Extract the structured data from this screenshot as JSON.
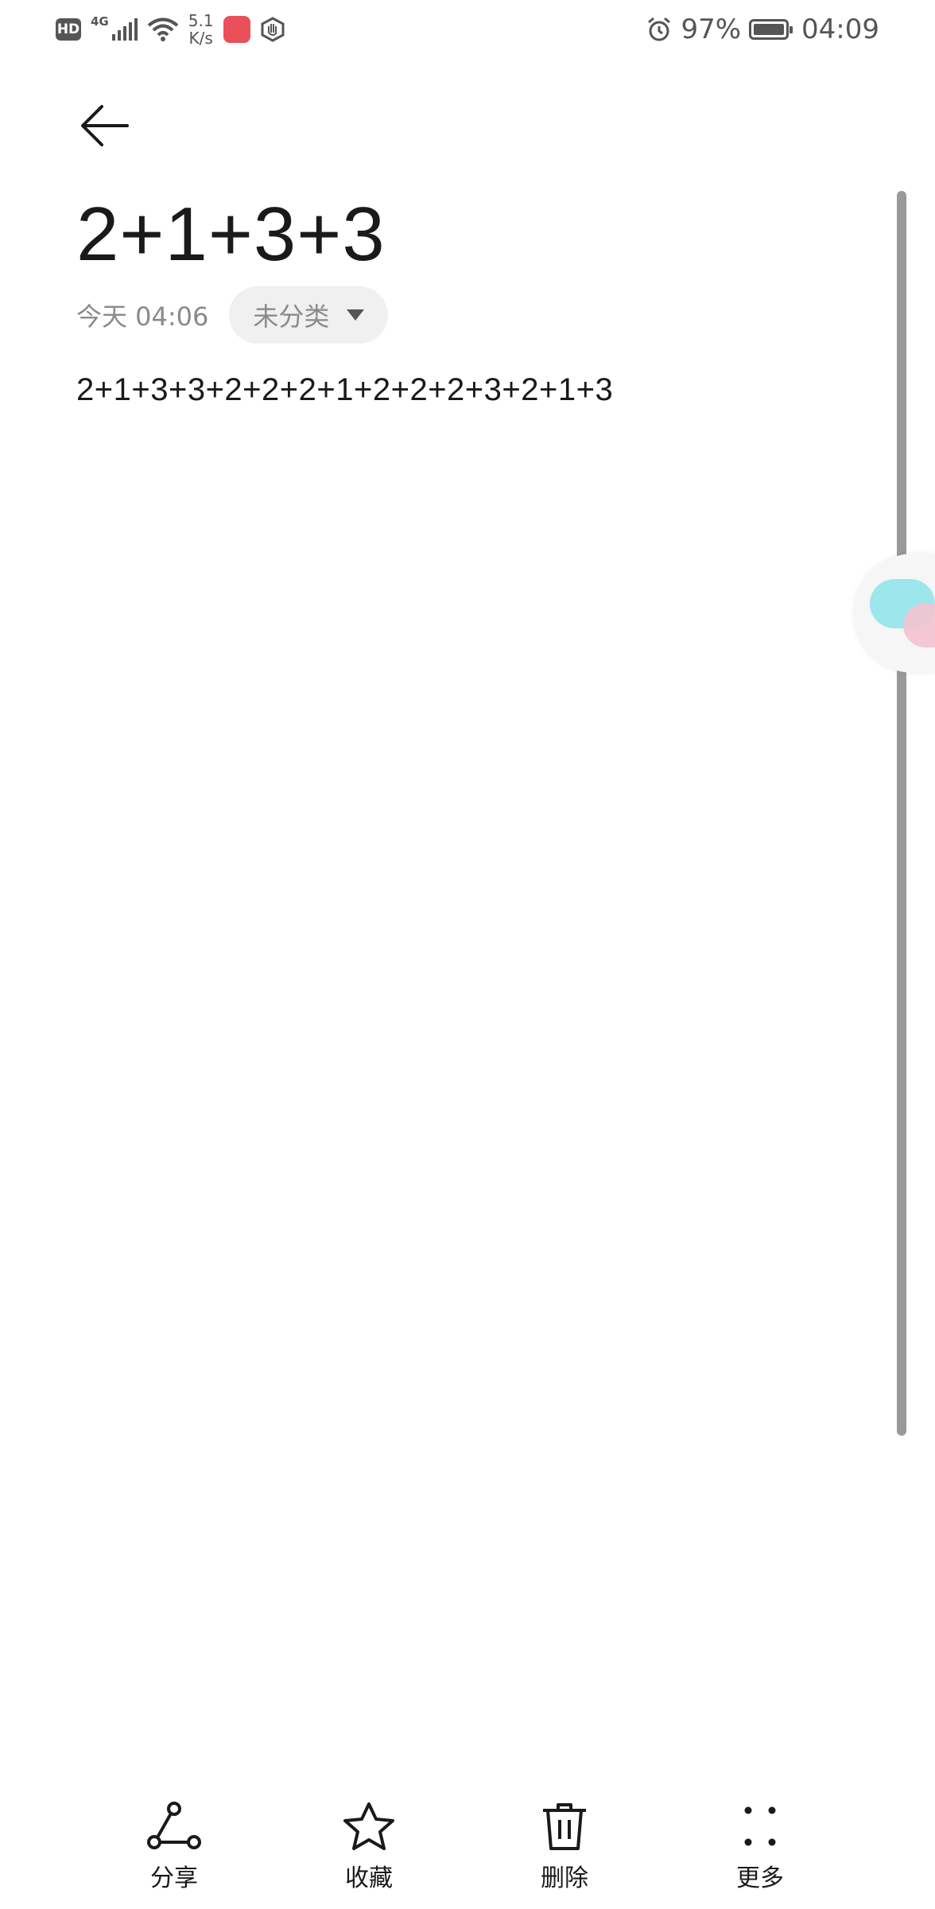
{
  "status_bar": {
    "hd": "HD",
    "network": "4G",
    "speed_value": "5.1",
    "speed_unit": "K/s",
    "battery": "97%",
    "time": "04:09"
  },
  "note": {
    "title": "2+1+3+3",
    "date": "今天 04:06",
    "category": "未分类",
    "content": "2+1+3+3+2+2+2+1+2+2+2+3+2+1+3"
  },
  "toolbar": {
    "share": "分享",
    "favorite": "收藏",
    "delete": "删除",
    "more": "更多"
  },
  "colors": {
    "text": "#1a1a1a",
    "secondary": "#8a8a8a",
    "chip_bg": "#f0f0f0",
    "scrollbar": "#9a9a9a"
  }
}
